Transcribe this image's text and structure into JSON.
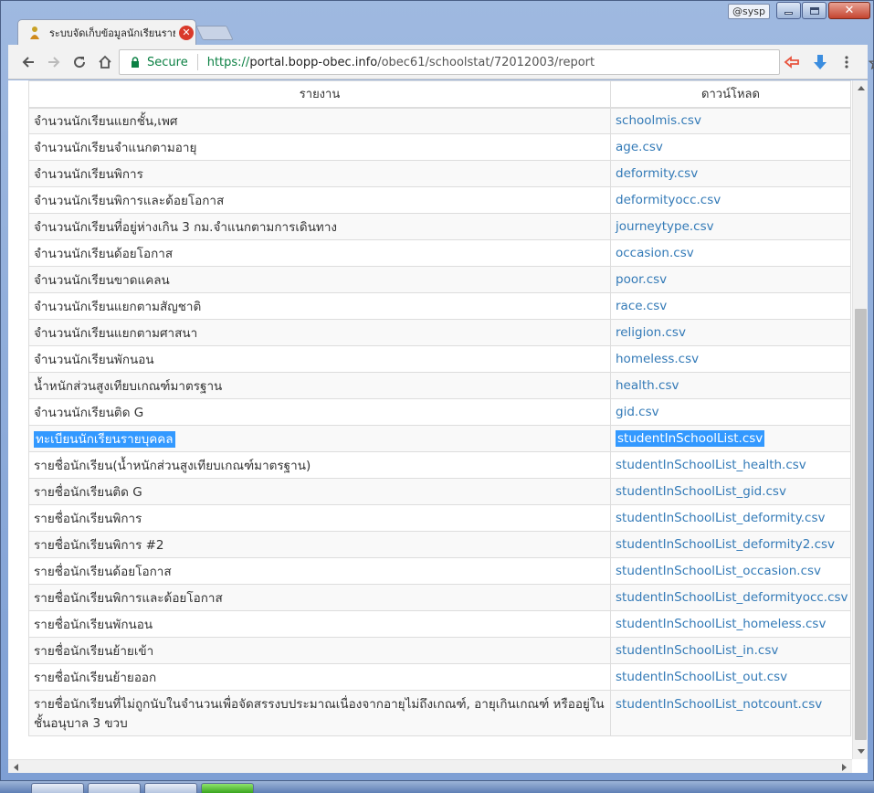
{
  "browser": {
    "tab_title": "ระบบจัดเก็บข้อมูลนักเรียนราย",
    "profile": "@sysp",
    "secure_label": "Secure",
    "url_scheme": "https://",
    "url_host": "portal.bopp-obec.info",
    "url_path": "/obec61/schoolstat/72012003/report"
  },
  "table": {
    "headers": [
      "รายงาน",
      "ดาวน์โหลด"
    ],
    "rows": [
      {
        "report": "จำนวนนักเรียนแยกชั้น,เพศ",
        "file": "schoolmis.csv"
      },
      {
        "report": "จำนวนนักเรียนจำแนกตามอายุ",
        "file": "age.csv"
      },
      {
        "report": "จำนวนนักเรียนพิการ",
        "file": "deformity.csv"
      },
      {
        "report": "จำนวนนักเรียนพิการและด้อยโอกาส",
        "file": "deformityocc.csv"
      },
      {
        "report": "จำนวนนักเรียนที่อยู่ห่างเกิน 3 กม.จำแนกตามการเดินทาง",
        "file": "journeytype.csv"
      },
      {
        "report": "จำนวนนักเรียนด้อยโอกาส",
        "file": "occasion.csv"
      },
      {
        "report": "จำนวนนักเรียนขาดแคลน",
        "file": "poor.csv"
      },
      {
        "report": "จำนวนนักเรียนแยกตามสัญชาติ",
        "file": "race.csv"
      },
      {
        "report": "จำนวนนักเรียนแยกตามศาสนา",
        "file": "religion.csv"
      },
      {
        "report": "จำนวนนักเรียนพักนอน",
        "file": "homeless.csv"
      },
      {
        "report": "น้ำหนักส่วนสูงเทียบเกณฑ์มาตรฐาน",
        "file": "health.csv"
      },
      {
        "report": "จำนวนนักเรียนติด G",
        "file": "gid.csv"
      },
      {
        "report": "ทะเบียนนักเรียนรายบุคคล",
        "file": "studentInSchoolList.csv"
      },
      {
        "report": "รายชื่อนักเรียน(น้ำหนักส่วนสูงเทียบเกณฑ์มาตรฐาน)",
        "file": "studentInSchoolList_health.csv"
      },
      {
        "report": "รายชื่อนักเรียนติด G",
        "file": "studentInSchoolList_gid.csv"
      },
      {
        "report": "รายชื่อนักเรียนพิการ",
        "file": "studentInSchoolList_deformity.csv"
      },
      {
        "report": "รายชื่อนักเรียนพิการ #2",
        "file": "studentInSchoolList_deformity2.csv"
      },
      {
        "report": "รายชื่อนักเรียนด้อยโอกาส",
        "file": "studentInSchoolList_occasion.csv"
      },
      {
        "report": "รายชื่อนักเรียนพิการและด้อยโอกาส",
        "file": "studentInSchoolList_deformityocc.csv"
      },
      {
        "report": "รายชื่อนักเรียนพักนอน",
        "file": "studentInSchoolList_homeless.csv"
      },
      {
        "report": "รายชื่อนักเรียนย้ายเข้า",
        "file": "studentInSchoolList_in.csv"
      },
      {
        "report": "รายชื่อนักเรียนย้ายออก",
        "file": "studentInSchoolList_out.csv"
      },
      {
        "report": "รายชื่อนักเรียนที่ไม่ถูกนับในจำนวนเพื่อจัดสรรงบประมาณเนื่องจากอายุไม่ถึงเกณฑ์, อายุเกินเกณฑ์ หรืออยู่ในชั้นอนุบาล 3 ขวบ",
        "file": "studentInSchoolList_notcount.csv"
      }
    ]
  },
  "colors": {
    "link": "#337ab7",
    "selection": "#3399ff",
    "secure_green": "#0b8043",
    "close_red": "#d93a2b"
  },
  "icons": {
    "favicon": "monk-figure-icon",
    "back": "back-arrow-icon",
    "forward": "forward-arrow-icon",
    "reload": "reload-icon",
    "home": "home-icon",
    "lock": "lock-icon",
    "bookmark": "star-icon",
    "ext1": "extension-icon",
    "ext2": "download-arrow-icon",
    "menu": "kebab-menu-icon"
  }
}
